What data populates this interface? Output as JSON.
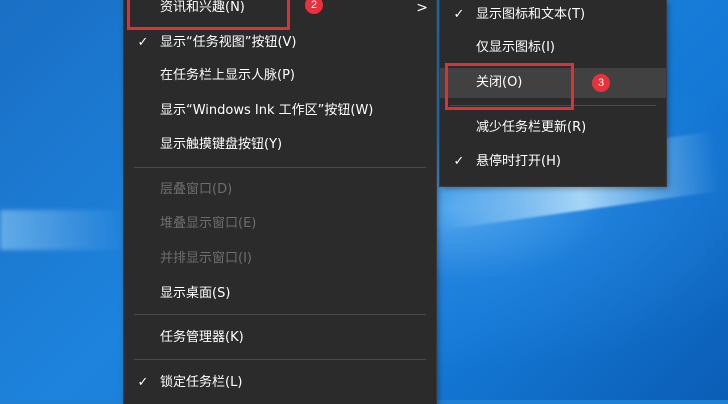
{
  "main_menu": {
    "items": [
      {
        "label": "资讯和兴趣(N)",
        "checked": false,
        "disabled": false,
        "has_submenu": true
      },
      {
        "label": "显示“任务视图”按钮(V)",
        "checked": true,
        "disabled": false
      },
      {
        "label": "在任务栏上显示人脉(P)",
        "checked": false,
        "disabled": false
      },
      {
        "label": "显示“Windows Ink 工作区”按钮(W)",
        "checked": false,
        "disabled": false
      },
      {
        "label": "显示触摸键盘按钮(Y)",
        "checked": false,
        "disabled": false
      },
      {
        "label": "层叠窗口(D)",
        "checked": false,
        "disabled": true
      },
      {
        "label": "堆叠显示窗口(E)",
        "checked": false,
        "disabled": true
      },
      {
        "label": "并排显示窗口(I)",
        "checked": false,
        "disabled": true
      },
      {
        "label": "显示桌面(S)",
        "checked": false,
        "disabled": false
      },
      {
        "label": "任务管理器(K)",
        "checked": false,
        "disabled": false
      },
      {
        "label": "锁定任务栏(L)",
        "checked": true,
        "disabled": false
      }
    ],
    "check_glyph": "✓",
    "submenu_arrow": ">"
  },
  "sub_menu": {
    "items": [
      {
        "label": "显示图标和文本(T)",
        "checked": true
      },
      {
        "label": "仅显示图标(I)",
        "checked": false
      },
      {
        "label": "关闭(O)",
        "checked": false,
        "highlighted": true
      },
      {
        "label": "减少任务栏更新(R)",
        "checked": false
      },
      {
        "label": "悬停时打开(H)",
        "checked": true
      }
    ]
  },
  "annotations": {
    "step2": "2",
    "step3": "3",
    "highlight_color": "#d9323b"
  },
  "colors": {
    "menu_bg": "#2b2b2b",
    "menu_text": "#ffffff",
    "disabled_text": "#6d6d6d",
    "hover_bg": "#414141",
    "desktop_blue": "#1f80d4"
  }
}
